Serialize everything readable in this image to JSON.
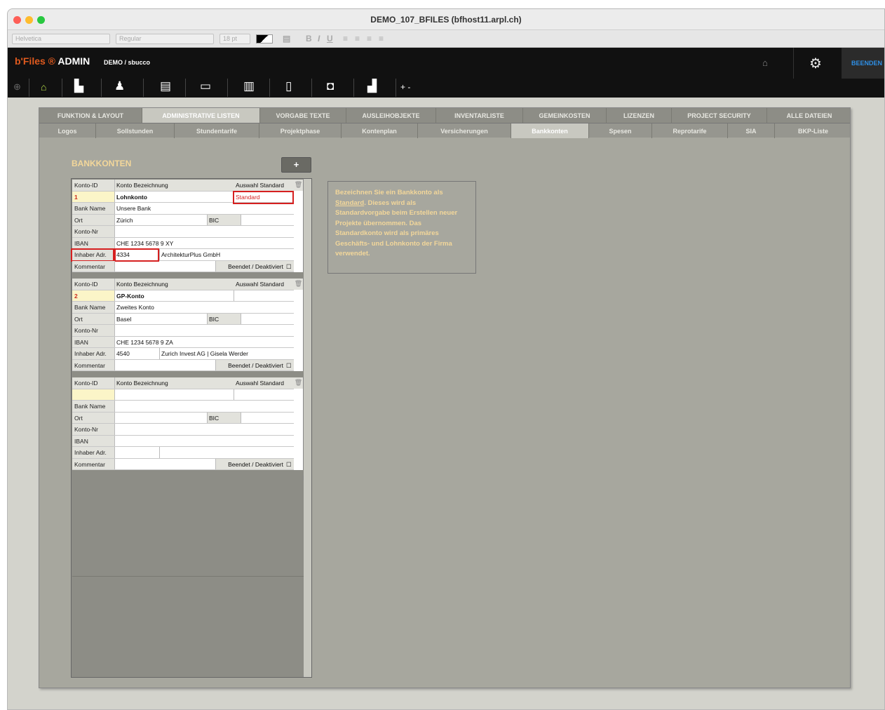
{
  "window": {
    "title": "DEMO_107_BFILES (bfhost11.arpl.ch)"
  },
  "format_bar": {
    "font": "Helvetica",
    "style": "Regular",
    "size": "18 pt",
    "bold": "B",
    "italic": "I",
    "underline": "U"
  },
  "header": {
    "logo_brand": "b'Files ®",
    "logo_admin": "ADMIN",
    "breadcrumb": "DEMO / sbucco",
    "end_button": "BEENDEN"
  },
  "toolbar_icons": [
    "home-icon",
    "building-icon",
    "people-icon",
    "contact-book-icon",
    "card-icon",
    "clipboard-icon",
    "document-icon",
    "bag-icon",
    "chart-icon"
  ],
  "tabs_row1": [
    "FUNKTION & LAYOUT",
    "ADMINISTRATIVE LISTEN",
    "VORGABE TEXTE",
    "AUSLEIHOBJEKTE",
    "INVENTARLISTE",
    "GEMEINKOSTEN",
    "LIZENZEN",
    "PROJECT SECURITY",
    "ALLE DATEIEN"
  ],
  "tabs_row2": [
    "Logos",
    "Sollstunden",
    "Stundentarife",
    "Projektphase",
    "Kontenplan",
    "Versicherungen",
    "Bankkonten",
    "Spesen",
    "Reprotarife",
    "SIA",
    "BKP-Liste"
  ],
  "section_title": "BANKKONTEN",
  "add_button": "+",
  "labels": {
    "konto_id": "Konto-ID",
    "bezeichnung": "Konto Bezeichnung",
    "auswahl": "Auswahl Standard",
    "bank_name": "Bank Name",
    "ort": "Ort",
    "bic": "BIC",
    "konto_nr": "Konto-Nr",
    "iban": "IBAN",
    "inhaber": "Inhaber Adr.",
    "kommentar": "Kommentar",
    "beendet": "Beendet / Deaktiviert"
  },
  "records": [
    {
      "id": "1",
      "name": "Lohnkonto",
      "standard": "Standard",
      "bank": "Unsere Bank",
      "ort": "Zürich",
      "bic": "",
      "konto_nr": "",
      "iban": "CHE 1234 5678 9 XY",
      "inhaber_nr": "4334",
      "inhaber_name": "ArchitekturPlus GmbH",
      "kommentar": ""
    },
    {
      "id": "2",
      "name": "GP-Konto",
      "standard": "",
      "bank": "Zweites Konto",
      "ort": "Basel",
      "bic": "",
      "konto_nr": "",
      "iban": "CHE 1234 5678 9 ZA",
      "inhaber_nr": "4540",
      "inhaber_name": "Zurich Invest AG  |  Gisela Werder",
      "kommentar": ""
    },
    {
      "id": "",
      "name": "",
      "standard": "",
      "bank": "",
      "ort": "",
      "bic": "",
      "konto_nr": "",
      "iban": "",
      "inhaber_nr": "",
      "inhaber_name": "",
      "kommentar": ""
    }
  ],
  "info": {
    "line1": "Bezeichnen Sie ein Bankkonto als",
    "underlined": "Standard",
    "line2": ". Dieses wird als Standardvorgabe beim Erstellen neuer Projekte übernommen. Das Standardkonto wird als primäres Geschäfts- und Lohnkonto der Firma verwendet."
  },
  "colors": {
    "accent_orange": "#e05a1e",
    "info_text": "#f3d79a",
    "highlight_red": "#d62020",
    "end_blue": "#2e8fe6"
  }
}
